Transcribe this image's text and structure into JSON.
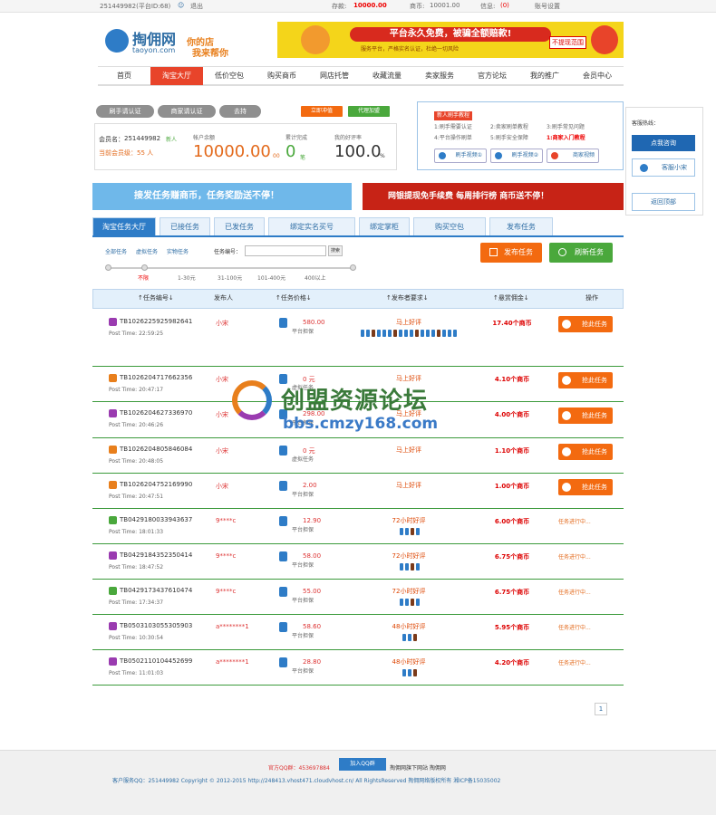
{
  "topbar": {
    "user": "251449982(平台ID:68)",
    "logout": "退出",
    "deposit_label": "存款:",
    "deposit_value": "10000.00",
    "coins_label": "商币:",
    "coins_value": "10001.00",
    "msg_label": "信息:",
    "msg_value": "(0)",
    "account": "账号设置"
  },
  "logo": {
    "name": "掏佣网",
    "domain": "taoyon.com",
    "slogan1": "你的店",
    "slogan2": "我来帮你"
  },
  "banner": {
    "text": "平台永久免费，被骗全额赔款!",
    "sub": "服务平台，严格实名认证，杜绝一切风险",
    "stamp": "不提现范围"
  },
  "nav": [
    "首页",
    "淘宝大厅",
    "低价空包",
    "购买商币",
    "网店托管",
    "收藏流量",
    "卖家服务",
    "官方论坛",
    "我的推广",
    "会员中心"
  ],
  "account": {
    "tabs": [
      "刷手请认证",
      "商家请认证",
      "去持"
    ],
    "buttons": [
      "立即冲值",
      "代理加盟"
    ],
    "member_label": "会员名：",
    "member": "251449982",
    "newbie": "新人",
    "level": "当前会员级：55 人",
    "balance_label": "帐户余额",
    "balance": "10000.00",
    "balance_unit": "00",
    "done_label": "累计完成",
    "done": "0",
    "done_unit": "笔",
    "rate_label": "我的好评率",
    "rate": "100.0",
    "rate_unit": "%"
  },
  "tutorial": {
    "title": "新人刷手教程",
    "items": [
      "1:刷手需要认证",
      "2:卖家刷单教程",
      "3:刷手常见问题",
      "4:平台操作刷单",
      "5:刷手安全保障",
      "1:商家入门教程"
    ],
    "videos": [
      "刷手视频①",
      "刷手视频②",
      "商家视频"
    ]
  },
  "side": {
    "hotline": "客服热线：",
    "qq_btn": "点我咨询",
    "service": "客服小宋",
    "back": "返回顶部"
  },
  "promo": {
    "left": "接发任务赚商币，任务奖励送不停！",
    "right": "网银提现免手续费 每周排行榜 商币送不停！"
  },
  "tabs": [
    "淘宝任务大厅",
    "已接任务",
    "已发任务",
    "绑定实名买号",
    "绑定掌柜",
    "购买空包",
    "发布任务"
  ],
  "filter": {
    "all": "全部任务",
    "virtual": "虚拟任务",
    "real": "实物任务",
    "id_label": "任务编号：",
    "search": "搜索",
    "publish": "发布任务",
    "refresh": "刷新任务",
    "slider": [
      "不限",
      "1-30元",
      "31-100元",
      "101-400元",
      "400以上"
    ]
  },
  "table_head": [
    "↑任务编号↓",
    "发布人",
    "↑任务价格↓",
    "↑发布者要求↓",
    "↑悬赏佣金↓",
    "操作"
  ],
  "rows": [
    {
      "id": "TB1026225925982641",
      "time": "Post Time: 22:59:25",
      "pub": "小宋",
      "price": "580.00",
      "plat": "平台担保",
      "req": "马上好评",
      "reward": "17.40个商币",
      "action": "抢此任务",
      "status": ""
    },
    {
      "id": "TB1026204717662356",
      "time": "Post Time: 20:47:17",
      "pub": "小宋",
      "price": "0 元",
      "plat": "虚拟任务",
      "req": "马上好评",
      "reward": "4.10个商币",
      "action": "抢此任务",
      "status": ""
    },
    {
      "id": "TB1026204627336970",
      "time": "Post Time: 20:46:26",
      "pub": "小宋",
      "price": "298.00",
      "plat": "平台担保",
      "req": "马上好评",
      "reward": "4.00个商币",
      "action": "抢此任务",
      "status": ""
    },
    {
      "id": "TB1026204805846084",
      "time": "Post Time: 20:48:05",
      "pub": "小宋",
      "price": "0 元",
      "plat": "虚拟任务",
      "req": "马上好评",
      "reward": "1.10个商币",
      "action": "抢此任务",
      "status": ""
    },
    {
      "id": "TB1026204752169990",
      "time": "Post Time: 20:47:51",
      "pub": "小宋",
      "price": "2.00",
      "plat": "平台担保",
      "req": "马上好评",
      "reward": "1.00个商币",
      "action": "抢此任务",
      "status": ""
    },
    {
      "id": "TB0429180033943637",
      "time": "Post Time: 18:01:33",
      "pub": "9****c",
      "price": "12.90",
      "plat": "平台担保",
      "req": "72小时好评",
      "reward": "6.00个商币",
      "action": "",
      "status": "任务进行中..."
    },
    {
      "id": "TB0429184352350414",
      "time": "Post Time: 18:47:52",
      "pub": "9****c",
      "price": "58.00",
      "plat": "平台担保",
      "req": "72小时好评",
      "reward": "6.75个商币",
      "action": "",
      "status": "任务进行中..."
    },
    {
      "id": "TB0429173437610474",
      "time": "Post Time: 17:34:37",
      "pub": "9****c",
      "price": "55.00",
      "plat": "平台担保",
      "req": "72小时好评",
      "reward": "6.75个商币",
      "action": "",
      "status": "任务进行中..."
    },
    {
      "id": "TB0503103055305903",
      "time": "Post Time: 10:30:54",
      "pub": "a********1",
      "price": "58.60",
      "plat": "平台担保",
      "req": "48小时好评",
      "reward": "5.95个商币",
      "action": "",
      "status": "任务进行中..."
    },
    {
      "id": "TB0502110104452699",
      "time": "Post Time: 11:01:03",
      "pub": "a********1",
      "price": "28.80",
      "plat": "平台担保",
      "req": "48小时好评",
      "reward": "4.20个商币",
      "action": "",
      "status": "任务进行中..."
    }
  ],
  "page": "1",
  "watermark": {
    "main": "创盟资源论坛",
    "url": "bbs.cmzy168.com"
  },
  "footer": {
    "qq": "官方QQ群：453697884",
    "join": "加入QQ群",
    "sub": "掏佣网旗下网站 掏佣网",
    "line2": "客户服务QQ：251449982 Copyright © 2012-2015 http://248413.vhost471.cloudvhost.cn/ All RightsReserved 掏佣网络版权所有 湘ICP备15035002"
  }
}
